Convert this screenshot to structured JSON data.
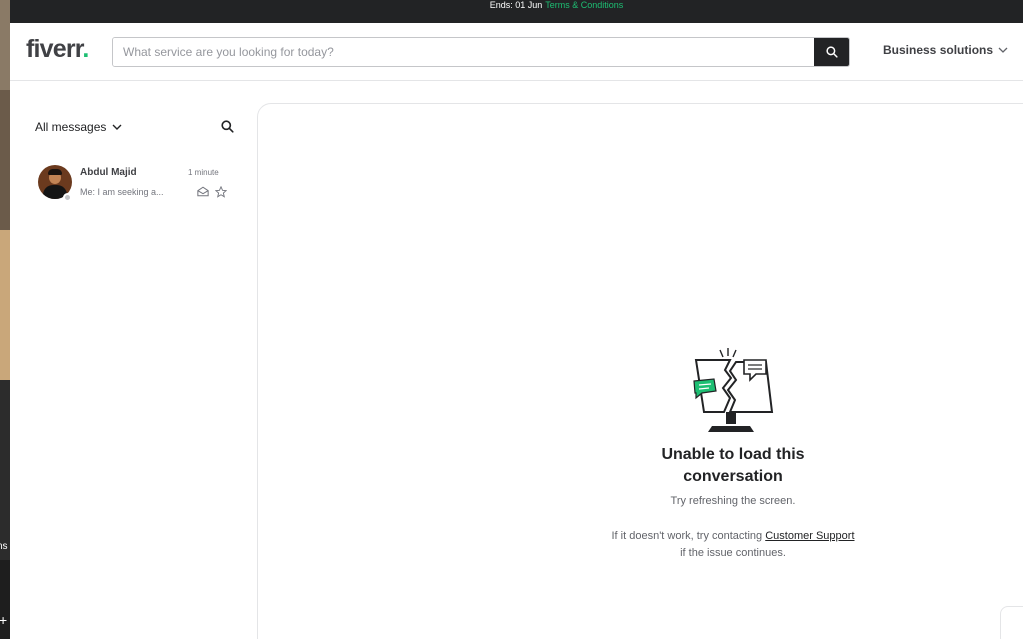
{
  "promo": {
    "text": "Ends: 01 Jun",
    "link": "Terms & Conditions"
  },
  "header": {
    "logo": "fiverr",
    "logo_dot": ".",
    "search_placeholder": "What service are you looking for today?",
    "business_label": "Business solutions"
  },
  "sidebar": {
    "filter_label": "All messages",
    "conversations": [
      {
        "name": "Abdul Majid",
        "time": "1 minute",
        "preview": "Me: I am seeking a..."
      }
    ]
  },
  "main": {
    "error_title": "Unable to load this conversation",
    "error_sub": "Try refreshing the screen.",
    "help_prefix": "If it doesn't work, try contacting ",
    "help_link": "Customer Support",
    "help_suffix": "if the issue continues."
  },
  "background_strip": {
    "text": "ns",
    "plus": "+"
  },
  "colors": {
    "brand_green": "#1dbf73",
    "dark": "#222325",
    "border": "#e4e5e7"
  }
}
